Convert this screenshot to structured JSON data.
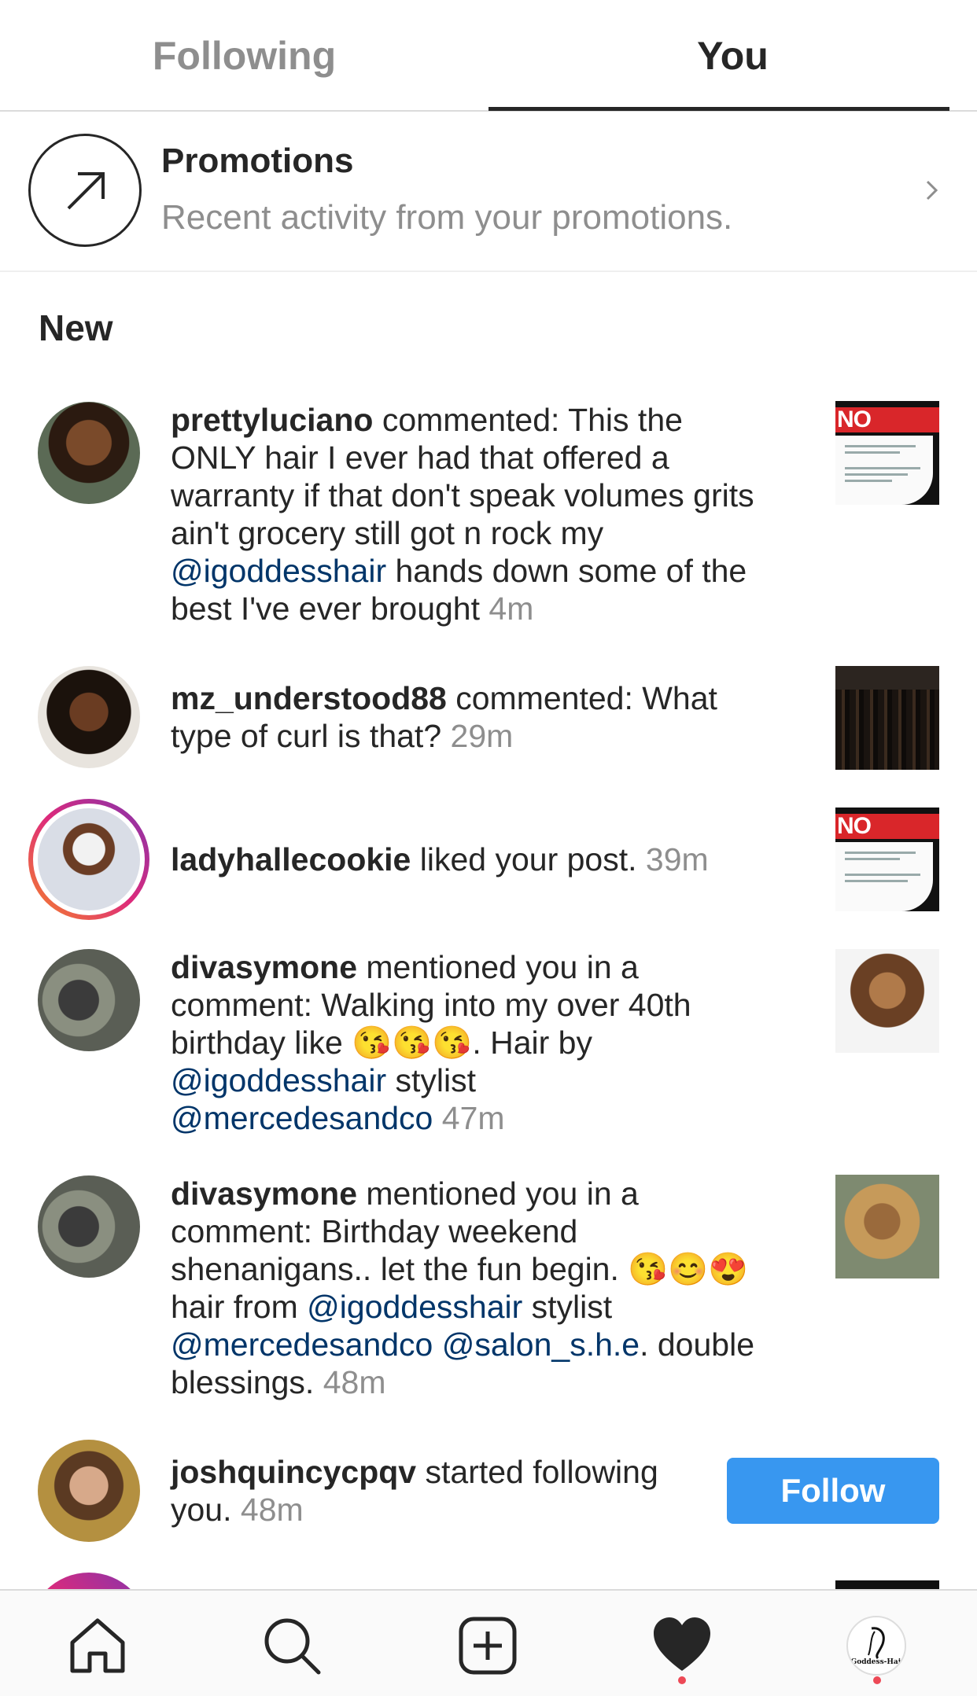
{
  "tabs": {
    "following": "Following",
    "you": "You"
  },
  "promotions": {
    "title": "Promotions",
    "subtitle": "Recent activity from your promotions."
  },
  "section": "New",
  "items": [
    {
      "user": "prettyluciano",
      "line1_rest": " commented: This the",
      "line2": "ONLY hair I ever had that offered a",
      "line3": "warranty if that don't speak volumes grits",
      "line4": "ain't grocery still got n rock my",
      "mention1": "@igoddesshair",
      "line5_rest": " hands down some of the",
      "line6": "best I've ever brought ",
      "time": "4m"
    },
    {
      "user": "mz_understood88",
      "line1_rest": " commented: What",
      "line2": "type of curl is that? ",
      "time": "29m"
    },
    {
      "user": "ladyhallecookie",
      "line1_rest": " liked your post. ",
      "time": "39m"
    },
    {
      "user": "divasymone",
      "line1_rest": " mentioned you in a",
      "line2": "comment: Walking into my over 40th",
      "line3": "birthday like 😘😘😘. Hair by",
      "mention1": "@igoddesshair",
      "line4_rest": " stylist",
      "mention2": "@mercedesandco",
      "time": "47m"
    },
    {
      "user": "divasymone",
      "line1_rest": " mentioned you in a",
      "line2": "comment: Birthday weekend",
      "line3": "shenanigans.. let the fun begin. 😘😊😍",
      "line4_pre": "hair from ",
      "mention1": "@igoddesshair",
      "line4_rest": " stylist",
      "mention2": "@mercedesandco",
      "mention3": "@salon_s.h.e",
      "line5_rest": ". double",
      "line6": "blessings. ",
      "time": "48m"
    },
    {
      "user": "joshquincycpqv",
      "line1_rest": " started following",
      "line2": "you. ",
      "time": "48m",
      "button": "Follow"
    }
  ],
  "thumb_labels": {
    "scam": "NO SCAM"
  },
  "profile_logo": "iGoddess-Hair",
  "icons": [
    "home-icon",
    "search-icon",
    "add-icon",
    "heart-icon",
    "profile-avatar"
  ],
  "colors": {
    "accent": "#3897f0",
    "mention": "#003569",
    "muted": "#8e8e8e",
    "notification": "#ed4956"
  }
}
